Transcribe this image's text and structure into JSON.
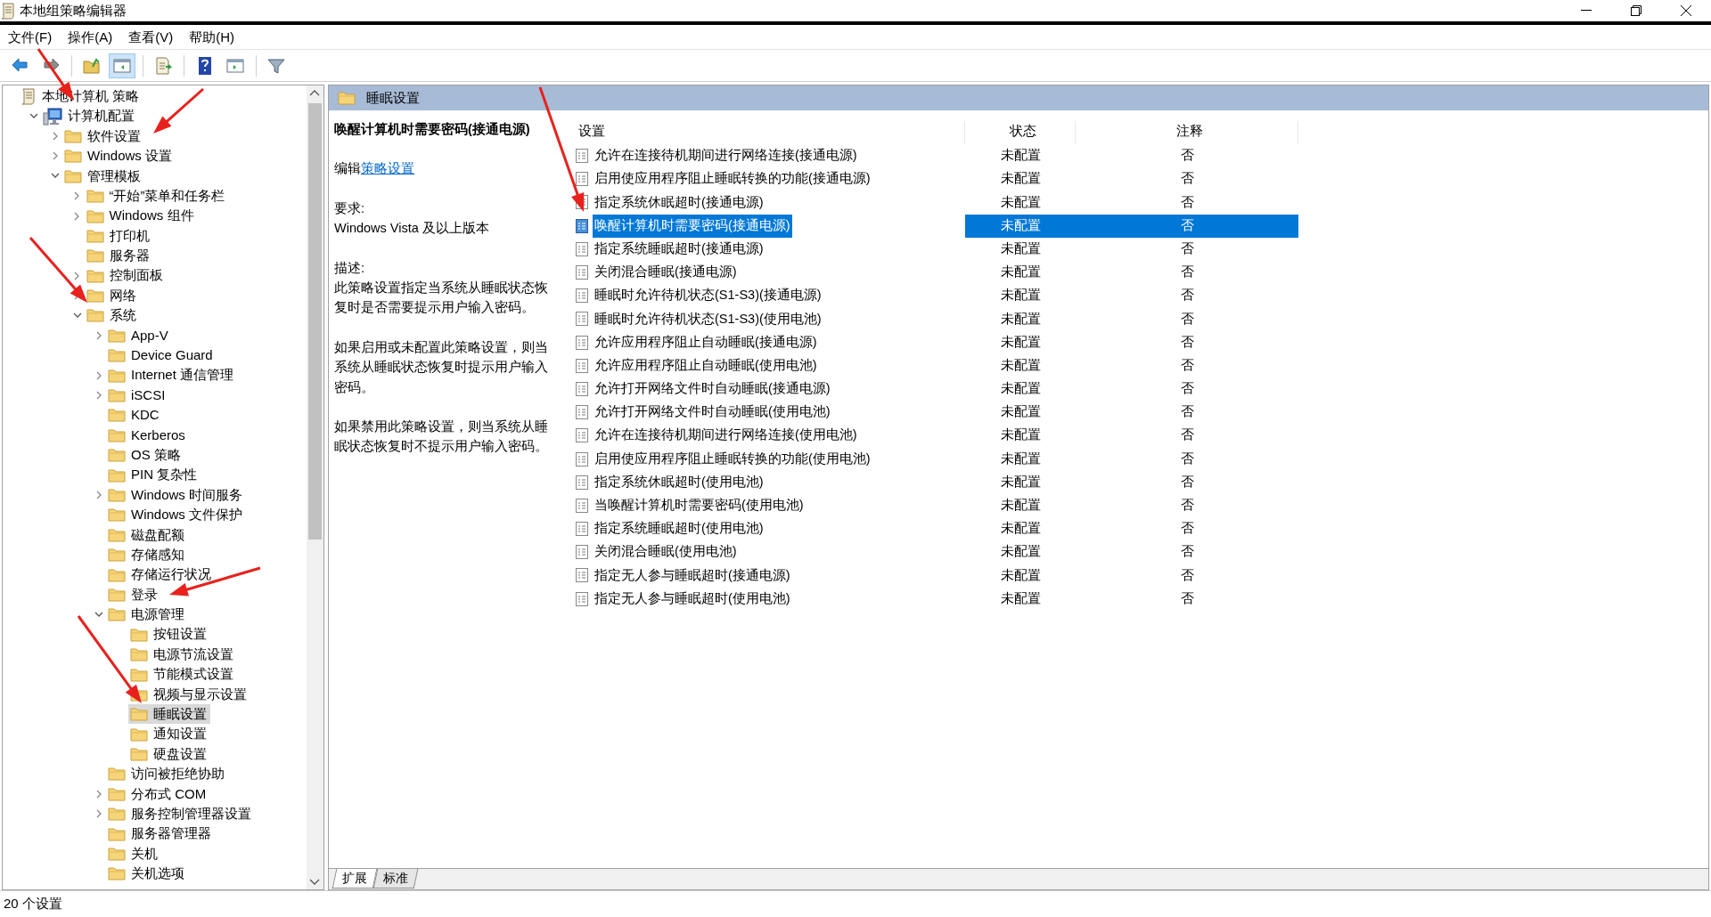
{
  "window": {
    "title": "本地组策略编辑器"
  },
  "menu": [
    "文件(F)",
    "操作(A)",
    "查看(V)",
    "帮助(H)"
  ],
  "tree": [
    {
      "label": "本地计算机 策略",
      "kind": "policy",
      "selected": false,
      "children": [
        {
          "label": "计算机配置",
          "kind": "computer",
          "expanded": true,
          "selected": false,
          "children": [
            {
              "label": "软件设置",
              "kind": "folder",
              "expanded": false,
              "selected": false
            },
            {
              "label": "Windows 设置",
              "kind": "folder",
              "expanded": false,
              "selected": false
            },
            {
              "label": "管理模板",
              "kind": "folder",
              "expanded": true,
              "selected": false,
              "children": [
                {
                  "label": "“开始”菜单和任务栏",
                  "kind": "folder",
                  "expanded": false,
                  "selected": false
                },
                {
                  "label": "Windows 组件",
                  "kind": "folder",
                  "expanded": false,
                  "selected": false
                },
                {
                  "label": "打印机",
                  "kind": "folder",
                  "selected": false
                },
                {
                  "label": "服务器",
                  "kind": "folder",
                  "selected": false
                },
                {
                  "label": "控制面板",
                  "kind": "folder",
                  "expanded": false,
                  "selected": false
                },
                {
                  "label": "网络",
                  "kind": "folder",
                  "expanded": false,
                  "selected": false
                },
                {
                  "label": "系统",
                  "kind": "folder",
                  "expanded": true,
                  "selected": false,
                  "children": [
                    {
                      "label": "App-V",
                      "kind": "folder",
                      "expanded": false,
                      "selected": false
                    },
                    {
                      "label": "Device Guard",
                      "kind": "folder",
                      "selected": false
                    },
                    {
                      "label": "Internet 通信管理",
                      "kind": "folder",
                      "expanded": false,
                      "selected": false
                    },
                    {
                      "label": "iSCSI",
                      "kind": "folder",
                      "expanded": false,
                      "selected": false
                    },
                    {
                      "label": "KDC",
                      "kind": "folder",
                      "selected": false
                    },
                    {
                      "label": "Kerberos",
                      "kind": "folder",
                      "selected": false
                    },
                    {
                      "label": "OS 策略",
                      "kind": "folder",
                      "selected": false
                    },
                    {
                      "label": "PIN 复杂性",
                      "kind": "folder",
                      "selected": false
                    },
                    {
                      "label": "Windows 时间服务",
                      "kind": "folder",
                      "expanded": false,
                      "selected": false
                    },
                    {
                      "label": "Windows 文件保护",
                      "kind": "folder",
                      "selected": false
                    },
                    {
                      "label": "磁盘配额",
                      "kind": "folder",
                      "selected": false
                    },
                    {
                      "label": "存储感知",
                      "kind": "folder",
                      "selected": false
                    },
                    {
                      "label": "存储运行状况",
                      "kind": "folder",
                      "selected": false
                    },
                    {
                      "label": "登录",
                      "kind": "folder",
                      "selected": false
                    },
                    {
                      "label": "电源管理",
                      "kind": "folder",
                      "expanded": true,
                      "selected": false,
                      "children": [
                        {
                          "label": "按钮设置",
                          "kind": "folder",
                          "selected": false
                        },
                        {
                          "label": "电源节流设置",
                          "kind": "folder",
                          "selected": false
                        },
                        {
                          "label": "节能模式设置",
                          "kind": "folder",
                          "selected": false
                        },
                        {
                          "label": "视频与显示设置",
                          "kind": "folder",
                          "selected": false
                        },
                        {
                          "label": "睡眠设置",
                          "kind": "folder",
                          "selected": true
                        },
                        {
                          "label": "通知设置",
                          "kind": "folder",
                          "selected": false
                        },
                        {
                          "label": "硬盘设置",
                          "kind": "folder",
                          "selected": false
                        }
                      ]
                    },
                    {
                      "label": "访问被拒绝协助",
                      "kind": "folder",
                      "selected": false
                    },
                    {
                      "label": "分布式 COM",
                      "kind": "folder",
                      "expanded": false,
                      "selected": false
                    },
                    {
                      "label": "服务控制管理器设置",
                      "kind": "folder",
                      "expanded": false,
                      "selected": false
                    },
                    {
                      "label": "服务器管理器",
                      "kind": "folder",
                      "selected": false
                    },
                    {
                      "label": "关机",
                      "kind": "folder",
                      "selected": false
                    },
                    {
                      "label": "关机选项",
                      "kind": "folder",
                      "selected": false
                    }
                  ]
                }
              ]
            }
          ]
        }
      ]
    }
  ],
  "pane_header": {
    "title": "睡眠设置"
  },
  "description": {
    "title": "唤醒计算机时需要密码(接通电源)",
    "edit_prefix": "编辑",
    "edit_link": "策略设置",
    "requirements_label": "要求:",
    "requirements": "Windows Vista 及以上版本",
    "description_label": "描述:",
    "paragraphs": [
      "此策略设置指定当系统从睡眠状态恢复时是否需要提示用户输入密码。",
      "如果启用或未配置此策略设置，则当系统从睡眠状态恢复时提示用户输入密码。",
      "如果禁用此策略设置，则当系统从睡眠状态恢复时不提示用户输入密码。"
    ]
  },
  "table": {
    "columns": [
      "设置",
      "状态",
      "注释"
    ],
    "rows": [
      {
        "setting": "允许在连接待机期间进行网络连接(接通电源)",
        "state": "未配置",
        "comment": "否",
        "selected": false
      },
      {
        "setting": "启用使应用程序阻止睡眠转换的功能(接通电源)",
        "state": "未配置",
        "comment": "否",
        "selected": false
      },
      {
        "setting": "指定系统休眠超时(接通电源)",
        "state": "未配置",
        "comment": "否",
        "selected": false
      },
      {
        "setting": "唤醒计算机时需要密码(接通电源)",
        "state": "未配置",
        "comment": "否",
        "selected": true
      },
      {
        "setting": "指定系统睡眠超时(接通电源)",
        "state": "未配置",
        "comment": "否",
        "selected": false
      },
      {
        "setting": "关闭混合睡眠(接通电源)",
        "state": "未配置",
        "comment": "否",
        "selected": false
      },
      {
        "setting": "睡眠时允许待机状态(S1-S3)(接通电源)",
        "state": "未配置",
        "comment": "否",
        "selected": false
      },
      {
        "setting": "睡眠时允许待机状态(S1-S3)(使用电池)",
        "state": "未配置",
        "comment": "否",
        "selected": false
      },
      {
        "setting": "允许应用程序阻止自动睡眠(接通电源)",
        "state": "未配置",
        "comment": "否",
        "selected": false
      },
      {
        "setting": "允许应用程序阻止自动睡眠(使用电池)",
        "state": "未配置",
        "comment": "否",
        "selected": false
      },
      {
        "setting": "允许打开网络文件时自动睡眠(接通电源)",
        "state": "未配置",
        "comment": "否",
        "selected": false
      },
      {
        "setting": "允许打开网络文件时自动睡眠(使用电池)",
        "state": "未配置",
        "comment": "否",
        "selected": false
      },
      {
        "setting": "允许在连接待机期间进行网络连接(使用电池)",
        "state": "未配置",
        "comment": "否",
        "selected": false
      },
      {
        "setting": "启用使应用程序阻止睡眠转换的功能(使用电池)",
        "state": "未配置",
        "comment": "否",
        "selected": false
      },
      {
        "setting": "指定系统休眠超时(使用电池)",
        "state": "未配置",
        "comment": "否",
        "selected": false
      },
      {
        "setting": "当唤醒计算机时需要密码(使用电池)",
        "state": "未配置",
        "comment": "否",
        "selected": false
      },
      {
        "setting": "指定系统睡眠超时(使用电池)",
        "state": "未配置",
        "comment": "否",
        "selected": false
      },
      {
        "setting": "关闭混合睡眠(使用电池)",
        "state": "未配置",
        "comment": "否",
        "selected": false
      },
      {
        "setting": "指定无人参与睡眠超时(接通电源)",
        "state": "未配置",
        "comment": "否",
        "selected": false
      },
      {
        "setting": "指定无人参与睡眠超时(使用电池)",
        "state": "未配置",
        "comment": "否",
        "selected": false
      }
    ]
  },
  "view_tabs": [
    {
      "label": "扩展",
      "selected": true
    },
    {
      "label": "标准",
      "selected": false
    }
  ],
  "status_bar": "20 个设置"
}
